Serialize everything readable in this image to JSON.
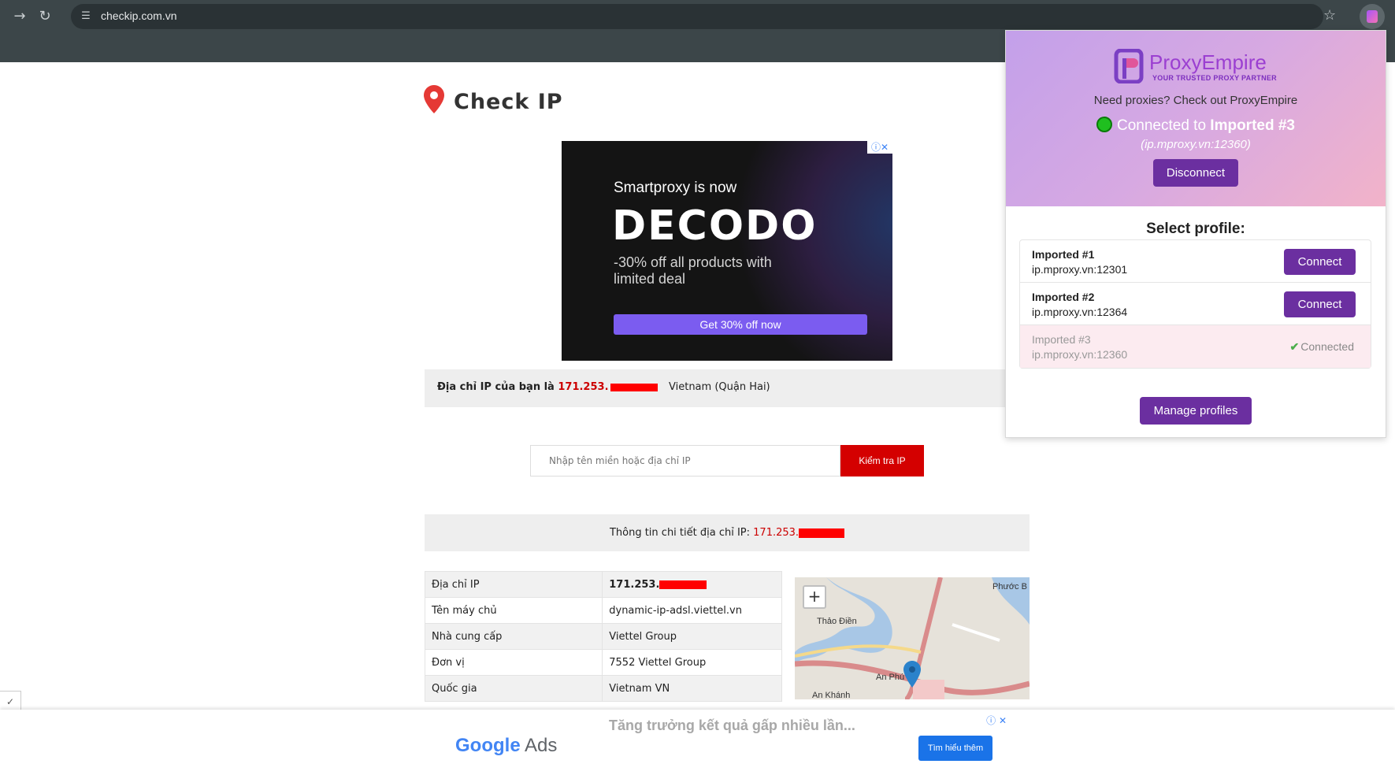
{
  "browser": {
    "url": "checkip.com.vn",
    "icons": {
      "forward": "arrow-right-icon",
      "reload": "reload-icon",
      "site_info": "tune-icon",
      "bookmark": "star-icon",
      "extension": "proxyempire-extension-icon"
    }
  },
  "site": {
    "logo_text": "Check IP",
    "ad_top": {
      "line1": "Smartproxy is now",
      "brand": "DECODO",
      "line2": "-30% off all products with limited deal",
      "cta": "Get 30% off now"
    },
    "ip_band": {
      "label": "Địa chỉ IP của bạn là",
      "ip": "171.253.",
      "location": "Vietnam (Quận Hai)"
    },
    "search": {
      "placeholder": "Nhập tên miền hoặc địa chỉ IP",
      "button": "Kiểm tra IP"
    },
    "detail": {
      "label": "Thông tin chi tiết địa chỉ IP:",
      "ip": "171.253."
    },
    "table": [
      {
        "key": "Địa chỉ IP",
        "value": "171.253."
      },
      {
        "key": "Tên máy chủ",
        "value": "dynamic-ip-adsl.viettel.vn"
      },
      {
        "key": "Nhà cung cấp",
        "value": "Viettel Group"
      },
      {
        "key": "Đơn vị",
        "value": "7552 Viettel Group"
      },
      {
        "key": "Quốc gia",
        "value": "Vietnam VN"
      }
    ],
    "map": {
      "zoom_in": "+",
      "places": [
        "Thảo Điền",
        "An Phú",
        "An Khánh",
        "Phước B"
      ]
    },
    "ad_bottom": {
      "brand_google": "Google",
      "brand_ads": "Ads",
      "headline": "Tăng trưởng kết quả gấp nhiều lần...",
      "cta": "Tìm hiểu thêm"
    },
    "cookie_tab": "✓"
  },
  "extension": {
    "brand": "ProxyEmpire",
    "tagline": "YOUR TRUSTED PROXY PARTNER",
    "promo": "Need proxies? Check out ProxyEmpire",
    "connected_prefix": "Connected to",
    "connected_profile": "Imported #3",
    "connected_host": "(ip.mproxy.vn:12360)",
    "disconnect": "Disconnect",
    "select_title": "Select profile:",
    "profiles": [
      {
        "name": "Imported #1",
        "host": "ip.mproxy.vn:12301",
        "action": "Connect"
      },
      {
        "name": "Imported #2",
        "host": "ip.mproxy.vn:12364",
        "action": "Connect"
      },
      {
        "name": "Imported #3",
        "host": "ip.mproxy.vn:12360",
        "status": "Connected"
      }
    ],
    "manage": "Manage profiles",
    "colors": {
      "accent": "#6b2fa0",
      "connected_dot": "#1fbf1f"
    }
  },
  "colors": {
    "ip_red": "#cc0000",
    "search_button": "#d40000"
  }
}
